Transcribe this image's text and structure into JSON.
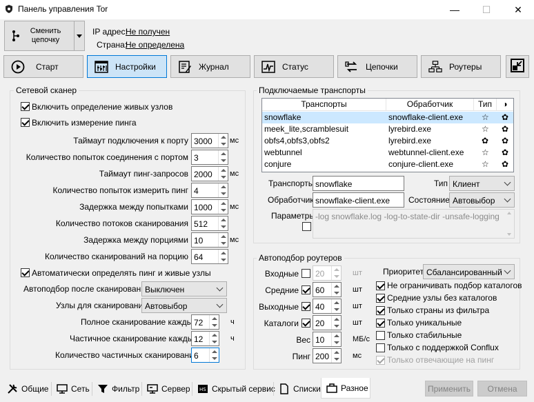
{
  "window": {
    "title": "Панель управления Tor",
    "minimize": "—",
    "maximize": "☐",
    "close": "✕"
  },
  "top": {
    "change_chain": "Сменить цепочку",
    "ip_label": "IP адрес:",
    "ip_value": "Не получен",
    "country_label": "Страна:",
    "country_value": "Не определена"
  },
  "nav": {
    "start": "Старт",
    "settings": "Настройки",
    "journal": "Журнал",
    "status": "Статус",
    "chains": "Цепочки",
    "routers": "Роутеры"
  },
  "scanner": {
    "title": "Сетевой сканер",
    "enable_live": "Включить определение живых узлов",
    "enable_ping": "Включить измерение пинга",
    "fields": [
      {
        "label": "Таймаут подключения к порту",
        "value": "3000",
        "unit": "мс"
      },
      {
        "label": "Количество попыток соединения с портом",
        "value": "3",
        "unit": ""
      },
      {
        "label": "Таймаут пинг-запросов",
        "value": "2000",
        "unit": "мс"
      },
      {
        "label": "Количество попыток измерить пинг",
        "value": "4",
        "unit": ""
      },
      {
        "label": "Задержка между попытками",
        "value": "1000",
        "unit": "мс"
      },
      {
        "label": "Количество потоков сканирования",
        "value": "512",
        "unit": ""
      },
      {
        "label": "Задержка между порциями",
        "value": "10",
        "unit": "мс"
      },
      {
        "label": "Количество сканирований на порцию",
        "value": "64",
        "unit": ""
      }
    ],
    "auto_detect": "Автоматически определять пинг и живые узлы",
    "auto_select_label": "Автоподбор после сканирования",
    "auto_select_value": "Выключен",
    "nodes_label": "Узлы для сканирования",
    "nodes_value": "Автовыбор",
    "full_scan_label": "Полное сканирование каждые",
    "full_scan_value": "72",
    "partial_scan_label": "Частичное сканирование каждые",
    "partial_scan_value": "12",
    "partial_count_label": "Количество частичных сканирований",
    "partial_count_value": "6",
    "hours_unit": "ч"
  },
  "transports": {
    "title": "Подключаемые транспорты",
    "headers": {
      "transports": "Транспорты",
      "handler": "Обработчик",
      "type": "Тип",
      "state": "◑"
    },
    "rows": [
      {
        "name": "snowflake",
        "handler": "snowflake-client.exe",
        "type": "☆",
        "state": "✿"
      },
      {
        "name": "meek_lite,scramblesuit",
        "handler": "lyrebird.exe",
        "type": "☆",
        "state": "✿"
      },
      {
        "name": "obfs4,obfs3,obfs2",
        "handler": "lyrebird.exe",
        "type": "✿",
        "state": "✿"
      },
      {
        "name": "webtunnel",
        "handler": "webtunnel-client.exe",
        "type": "☆",
        "state": "✿"
      },
      {
        "name": "conjure",
        "handler": "conjure-client.exe",
        "type": "☆",
        "state": "✿"
      }
    ],
    "transport_label": "Транспорты",
    "transport_value": "snowflake",
    "type_label": "Тип",
    "type_value": "Клиент",
    "handler_label": "Обработчик",
    "handler_value": "snowflake-client.exe",
    "state_label": "Состояние",
    "state_value": "Автовыбор",
    "params_label": "Параметры",
    "params_value": "-log snowflake.log -log-to-state-dir -unsafe-logging"
  },
  "routers": {
    "title": "Автоподбор роутеров",
    "entry_label": "Входные",
    "entry_value": "20",
    "entry_unit": "шт",
    "middle_label": "Средние",
    "middle_value": "60",
    "middle_unit": "шт",
    "exit_label": "Выходные",
    "exit_value": "40",
    "exit_unit": "шт",
    "catalogs_label": "Каталоги",
    "catalogs_value": "20",
    "catalogs_unit": "шт",
    "weight_label": "Вес",
    "weight_value": "10",
    "weight_unit": "МБ/с",
    "ping_label": "Пинг",
    "ping_value": "200",
    "ping_unit": "мс",
    "priority_label": "Приоритет",
    "priority_value": "Сбалансированный",
    "options": [
      "Не ограничивать подбор каталогов",
      "Средние узлы без каталогов",
      "Только страны из фильтра",
      "Только уникальные",
      "Только стабильные",
      "Только с поддержкой Conflux",
      "Только отвечающие на пинг"
    ]
  },
  "tabs": {
    "general": "Общие",
    "network": "Сеть",
    "filter": "Фильтр",
    "server": "Сервер",
    "hidden": "Скрытый сервис",
    "lists": "Списки",
    "misc": "Разное"
  },
  "buttons": {
    "apply": "Применить",
    "cancel": "Отмена"
  }
}
